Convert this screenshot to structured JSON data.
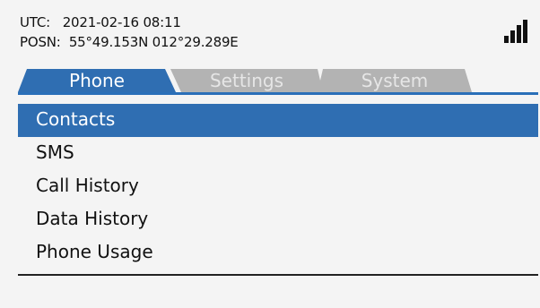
{
  "status": {
    "utc_label": "UTC:",
    "utc_value": "2021-02-16 08:11",
    "posn_label": "POSN:",
    "posn_value": "55°49.153N 012°29.289E"
  },
  "signal": {
    "icon": "signal-strength-icon",
    "bars_lit": 4,
    "bars_total": 4
  },
  "tabs": [
    {
      "label": "Phone",
      "active": true
    },
    {
      "label": "Settings",
      "active": false
    },
    {
      "label": "System",
      "active": false
    }
  ],
  "menu": {
    "items": [
      {
        "label": "Contacts",
        "selected": true
      },
      {
        "label": "SMS",
        "selected": false
      },
      {
        "label": "Call History",
        "selected": false
      },
      {
        "label": "Data History",
        "selected": false
      },
      {
        "label": "Phone Usage",
        "selected": false
      }
    ]
  },
  "colors": {
    "accent": "#2f6eb2",
    "tab_inactive": "#b3b3b3",
    "background": "#f4f4f4",
    "text": "#111111"
  }
}
